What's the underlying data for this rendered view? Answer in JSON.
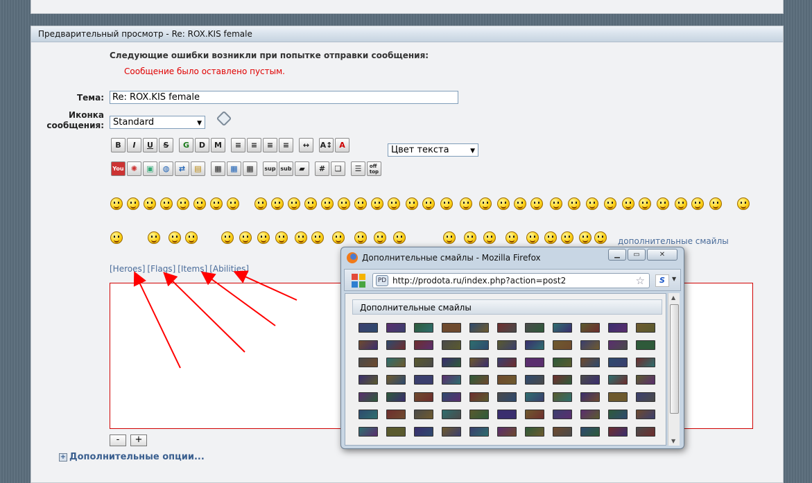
{
  "preview": {
    "header": "Предварительный просмотр - Re: ROX.KIS female",
    "errors_title": "Следующие ошибки возникли при попытке отправки сообщения:",
    "error_message": "Сообщение было оставлено пустым."
  },
  "form": {
    "subject_label": "Тема:",
    "subject_value": "Re: ROX.KIS female",
    "icon_label_line1": "Иконка",
    "icon_label_line2": "сообщения:",
    "icon_select_value": "Standard",
    "color_select_value": "Цвет текста",
    "extra_smilies_link": "дополнительные смайлы",
    "tag_links": [
      "[Heroes]",
      "[Flags]",
      "[Items]",
      "[Abilities]"
    ],
    "shrink_button": "-",
    "grow_button": "+",
    "more_options": "Дополнительные опции..."
  },
  "toolbar_row1": [
    "B",
    "I",
    "U",
    "S",
    "G",
    "D",
    "M",
    "align-left",
    "align-center",
    "align-center2",
    "justify",
    "hr",
    "font-size",
    "font-color"
  ],
  "toolbar_row2": [
    "youtube",
    "rutube",
    "image",
    "globe",
    "swap",
    "gallery",
    "table1",
    "table2",
    "table3",
    "sup",
    "sub",
    "book",
    "#",
    "quote",
    "list",
    "offtop"
  ],
  "popup": {
    "title": "Дополнительные смайлы - Mozilla Firefox",
    "url": "http://prodota.ru/index.php?action=post2",
    "pd_badge": "PD",
    "panel_title": "Дополнительные смайлы",
    "s_badge": "S"
  },
  "colors": {
    "error": "#e00000",
    "link": "#4a6c9a",
    "arrow": "#ff0000",
    "textarea_border": "#d00000"
  }
}
